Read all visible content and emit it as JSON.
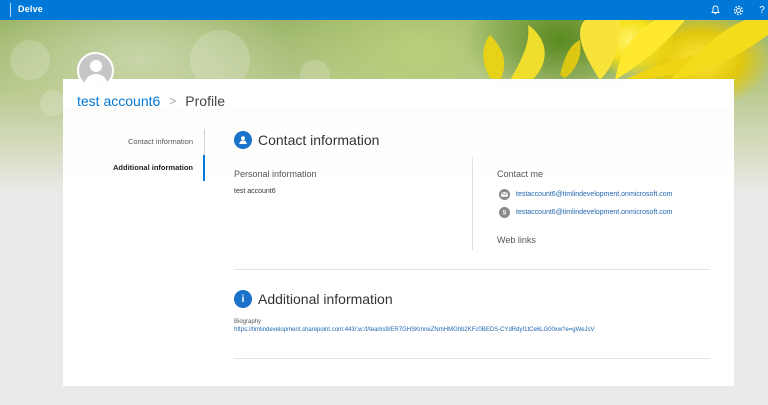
{
  "topbar": {
    "app_name": "Delve",
    "icons": [
      "bell-icon",
      "gear-icon",
      "help-icon"
    ],
    "help_glyph": "?"
  },
  "breadcrumb": {
    "name": "test account6",
    "separator": ">",
    "page": "Profile"
  },
  "nav": {
    "items": [
      {
        "label": "Contact information",
        "active": false
      },
      {
        "label": "Additional information",
        "active": true
      }
    ]
  },
  "contact": {
    "title": "Contact information",
    "personal_label": "Personal information",
    "personal_value": "test account6",
    "contact_me_label": "Contact me",
    "email": "testaccount6@timlindevelopment.onmicrosoft.com",
    "skype": "testaccount6@timlindevelopment.onmicrosoft.com",
    "web_links_label": "Web links"
  },
  "additional": {
    "title": "Additional information",
    "icon_glyph": "i",
    "biography_label": "Biography",
    "biography_link": "https://timlindevelopment.sharepoint.com:443/:w:/t/teams9/ER7GHSKmneZNmHMGhb2KFc0BEDS-CYdRdyI1tCe6LG00xw?e=gWeJsV"
  },
  "colors": {
    "accent": "#0078d7",
    "link": "#1f66b0",
    "section_icon": "#1a73c9"
  }
}
